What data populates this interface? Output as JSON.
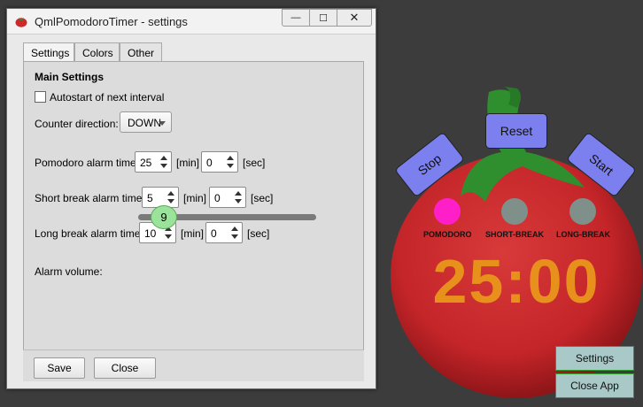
{
  "window": {
    "title": "QmlPomodoroTimer - settings",
    "controls": {
      "minimize": "—",
      "maximize": "☐",
      "close": "✕"
    }
  },
  "tabs": [
    {
      "label": "Settings",
      "active": true
    },
    {
      "label": "Colors",
      "active": false
    },
    {
      "label": "Other",
      "active": false
    }
  ],
  "settings": {
    "section_title": "Main Settings",
    "autostart": {
      "label": "Autostart of next interval",
      "checked": false
    },
    "counter_direction": {
      "label": "Counter direction:",
      "value": "DOWN"
    },
    "pomodoro_alarm": {
      "label": "Pomodoro alarm time",
      "min": "25",
      "min_unit": "[min]",
      "sec": "0",
      "sec_unit": "[sec]"
    },
    "short_break_alarm": {
      "label": "Short break alarm time",
      "min": "5",
      "min_unit": "[min]",
      "sec": "0",
      "sec_unit": "[sec]"
    },
    "long_break_alarm": {
      "label": "Long break alarm time",
      "min": "10",
      "min_unit": "[min]",
      "sec": "0",
      "sec_unit": "[sec]"
    },
    "alarm_volume": {
      "label": "Alarm volume:",
      "value": "9",
      "fraction": 0.1
    }
  },
  "dialog_buttons": {
    "save": "Save",
    "close": "Close"
  },
  "timer_app": {
    "buttons": {
      "stop": "Stop",
      "reset": "Reset",
      "start": "Start"
    },
    "modes": [
      {
        "label": "POMODORO",
        "active": true,
        "color": "#ff1fc8"
      },
      {
        "label": "SHORT-BREAK",
        "active": false,
        "color": "#7f8f8a"
      },
      {
        "label": "LONG-BREAK",
        "active": false,
        "color": "#7f8f8a"
      }
    ],
    "time": "25:00",
    "side_buttons": {
      "settings": "Settings",
      "close_app": "Close App"
    }
  },
  "colors": {
    "tomato_red": "#c8282c",
    "leaf_green": "#2f8f2f",
    "timer_orange": "#e8901c",
    "button_blue": "#7b80ee"
  }
}
